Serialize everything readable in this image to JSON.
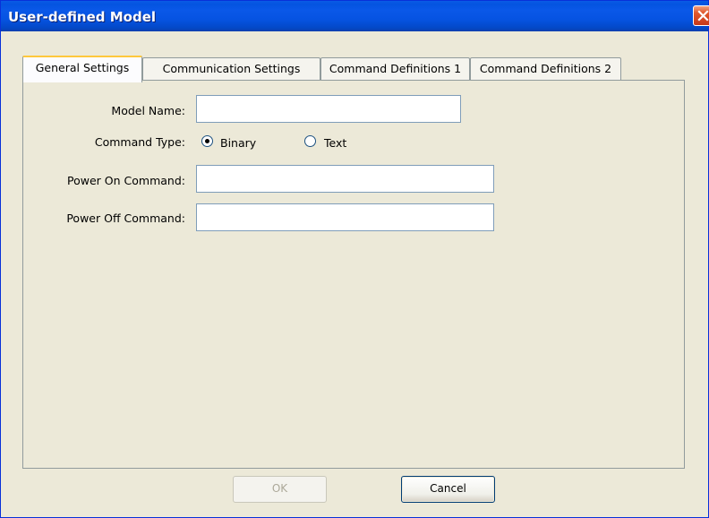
{
  "window": {
    "title": "User-defined Model"
  },
  "tabs": [
    {
      "label": "General Settings",
      "active": true
    },
    {
      "label": "Communication Settings",
      "active": false
    },
    {
      "label": "Command Definitions 1",
      "active": false
    },
    {
      "label": "Command Definitions 2",
      "active": false
    }
  ],
  "form": {
    "model_name": {
      "label": "Model Name:",
      "value": ""
    },
    "command_type": {
      "label": "Command Type:",
      "options": [
        {
          "label": "Binary",
          "selected": true
        },
        {
          "label": "Text",
          "selected": false
        }
      ]
    },
    "power_on": {
      "label": "Power On Command:",
      "value": ""
    },
    "power_off": {
      "label": "Power Off Command:",
      "value": ""
    }
  },
  "buttons": {
    "ok_label": "OK",
    "ok_enabled": false,
    "cancel_label": "Cancel"
  },
  "colors": {
    "titlebar": "#0454e0",
    "face": "#ece9d8",
    "close": "#e0582c",
    "active_tab_accent": "#ffc83c"
  }
}
